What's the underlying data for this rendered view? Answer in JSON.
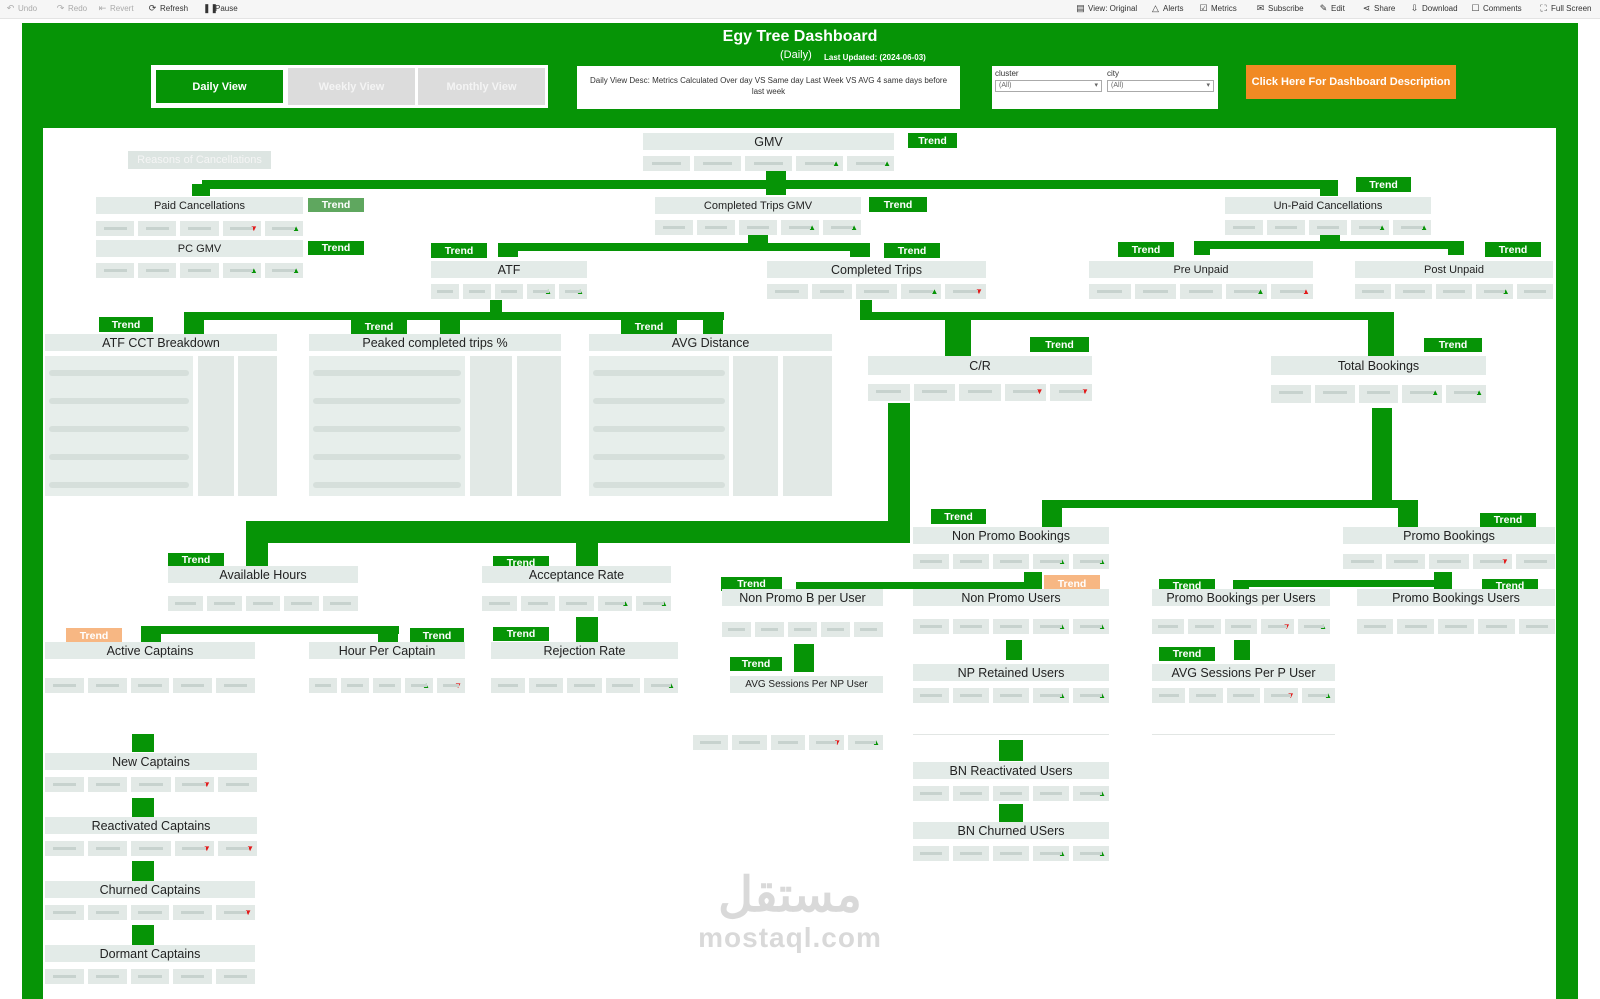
{
  "toolbar": {
    "undo": "Undo",
    "redo": "Redo",
    "revert": "Revert",
    "refresh": "Refresh",
    "pause": "Pause",
    "view_original": "View: Original",
    "alerts": "Alerts",
    "metrics": "Metrics",
    "subscribe": "Subscribe",
    "edit": "Edit",
    "share": "Share",
    "download": "Download",
    "comments": "Comments",
    "full_screen": "Full Screen"
  },
  "header": {
    "title": "Egy Tree Dashboard",
    "subtitle": "(Daily)",
    "last_updated": "Last Updated: (2024-06-03)"
  },
  "views": {
    "daily": "Daily View",
    "weekly": "Weekly View",
    "monthly": "Monthly View"
  },
  "description": "Daily View Desc: Metrics Calculated Over day VS Same day Last Week VS AVG 4 same days before last week",
  "filters": {
    "cluster": {
      "label": "cluster",
      "value": "(All)"
    },
    "city": {
      "label": "city",
      "value": "(All)"
    }
  },
  "desc_button": "Click Here For Dashboard Description",
  "trend_label": "Trend",
  "reasons": "Reasons of Cancellations",
  "metrics": {
    "gmv": "GMV",
    "paid_cancellations": "Paid Cancellations",
    "pc_gmv": "PC GMV",
    "completed_trips_gmv": "Completed Trips GMV",
    "unpaid_cancellations": "Un-Paid Cancellations",
    "atf": "ATF",
    "completed_trips": "Completed Trips",
    "pre_unpaid": "Pre Unpaid",
    "post_unpaid": "Post Unpaid",
    "atf_cct": "ATF CCT Breakdown",
    "peaked": "Peaked completed trips %",
    "avg_distance": "AVG Distance",
    "cr": "C/R",
    "total_bookings": "Total Bookings",
    "non_promo_bookings": "Non Promo Bookings",
    "promo_bookings": "Promo Bookings",
    "available_hours": "Available Hours",
    "acceptance_rate": "Acceptance Rate",
    "non_promo_b_per_user": "Non Promo B per User",
    "non_promo_users": "Non Promo Users",
    "promo_bookings_per_users": "Promo Bookings per Users",
    "promo_bookings_users": "Promo Bookings Users",
    "active_captains": "Active Captains",
    "hour_per_captain": "Hour Per Captain",
    "rejection_rate": "Rejection Rate",
    "avg_sessions_np": "AVG Sessions Per NP User",
    "np_retained_users": "NP Retained Users",
    "avg_sessions_p": "AVG Sessions Per P User",
    "new_captains": "New Captains",
    "reactivated_captains": "Reactivated Captains",
    "churned_captains": "Churned Captains",
    "dormant_captains": "Dormant Captains",
    "bn_reactivated": "BN Reactivated Users",
    "bn_churned": "BN Churned USers"
  },
  "watermark": {
    "arabic": "مستقل",
    "latin": "mostaql.com"
  },
  "colors": {
    "brand_green": "#069406",
    "orange": "#f18a23",
    "light_orange": "#f7b783"
  }
}
